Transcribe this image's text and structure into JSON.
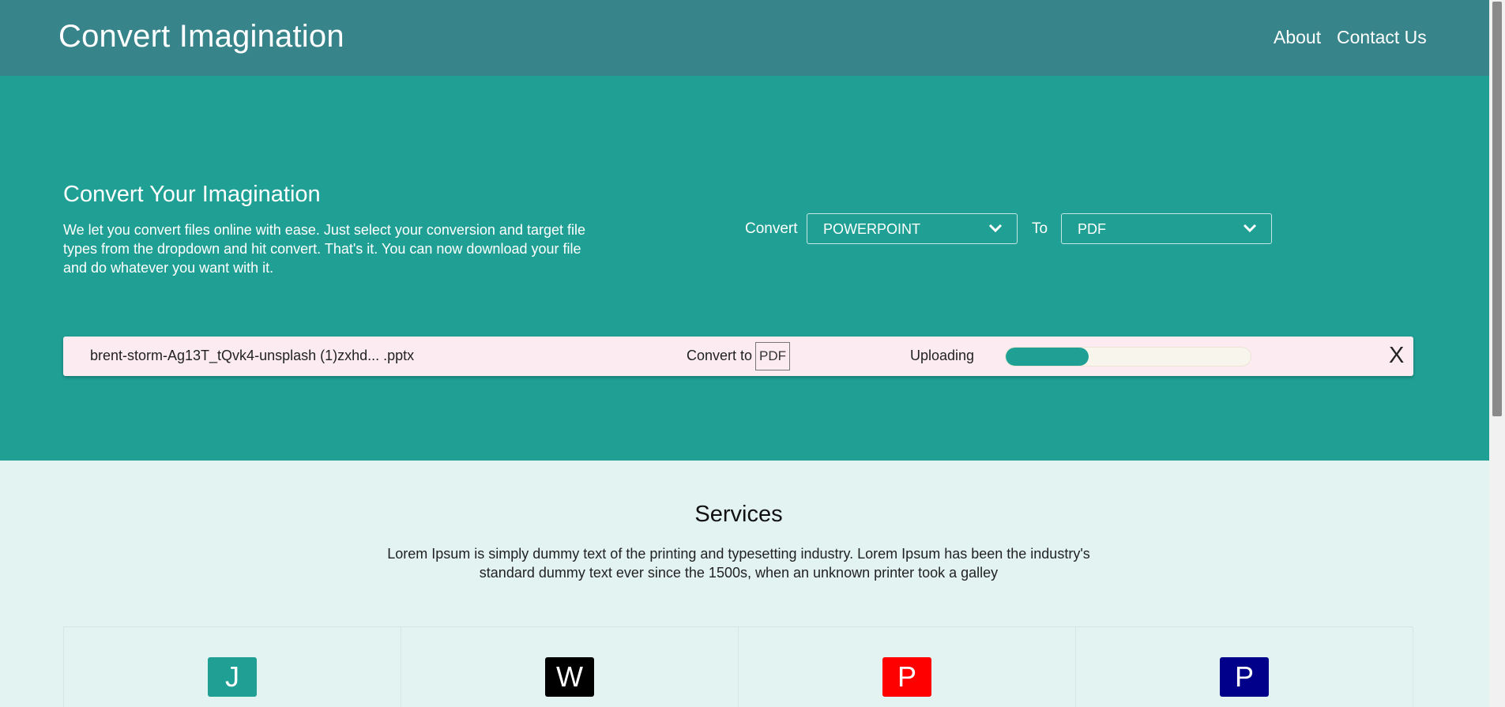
{
  "header": {
    "brand": "Convert Imagination",
    "nav": [
      "About",
      "Contact Us"
    ]
  },
  "hero": {
    "title": "Convert Your Imagination",
    "description": "We let you convert files online with ease. Just select your conversion and target file types from the dropdown and hit convert. That's it. You can now download your file and do whatever you want with it.",
    "convert_label": "Convert",
    "from_value": "POWERPOINT",
    "to_label": "To",
    "to_value": "PDF"
  },
  "file_item": {
    "name": "brent-storm-Ag13T_tQvk4-unsplash (1)zxhd... .pptx",
    "convert_to_label": "Convert to",
    "convert_to_value": "PDF",
    "status": "Uploading",
    "progress_fraction": 0.34,
    "close_label": "X"
  },
  "services": {
    "title": "Services",
    "description": "Lorem Ipsum is simply dummy text of the printing and typesetting industry. Lorem Ipsum has been the industry's standard dummy text ever since the 1500s, when an unknown printer took a galley",
    "cards": [
      {
        "letter": "J",
        "color": "#20a095"
      },
      {
        "letter": "W",
        "color": "#000000"
      },
      {
        "letter": "P",
        "color": "#ff0000"
      },
      {
        "letter": "P",
        "color": "#00008b"
      }
    ]
  },
  "colors": {
    "navbar": "#37848a",
    "hero": "#20a095",
    "page_bg": "#e3f3f2",
    "file_row_bg": "#fcecf1"
  }
}
